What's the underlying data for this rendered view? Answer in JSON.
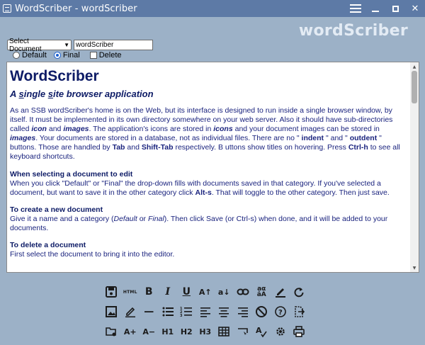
{
  "window": {
    "title": "WordScriber - wordScriber",
    "brand": "wordScriber"
  },
  "controls": {
    "select_value": "Select Document",
    "doc_name_value": "wordScriber",
    "options": [
      {
        "label": "Default",
        "checked": false
      },
      {
        "label": "Final",
        "checked": true
      }
    ],
    "delete_label": "Delete"
  },
  "content": {
    "heading": "WordScriber",
    "subheading_pre": "A ",
    "subheading_u": "s",
    "subheading_mid": "ingle ",
    "subheading_u2": "s",
    "subheading_post": "ite browser application",
    "intro": {
      "t1": "As an SSB wordScriber's home is on the Web, but its interface is designed to run inside a single browser window, by itself. It must be implemented in its own directory somewhere on your web server. Also it should have sub-directories called ",
      "b1": "icon",
      "t2": " and ",
      "b2": "images",
      "t3": ". The application's icons are stored in ",
      "b3": "icons",
      "t4": " and your document images can be stored in ",
      "b4": "images",
      "t5": ". Your documents are stored in a database, not as individual files.  There are no \"",
      "b5": " indent ",
      "t6": "\" and \" ",
      "b6": "outdent",
      "t7": " \" buttons. Those are handled by  ",
      "b7": "Tab",
      "t8": "  and  ",
      "b8": "Shift-Tab",
      "t9": "  respectively. B uttons  show  titles on hovering. Press  ",
      "b9": "Ctrl-h",
      "t10": "  to see all keyboard shortcuts."
    },
    "sec1": {
      "title": "When selecting a document to edit",
      "t1": "When you click \"Default\" or \"Final\" the drop-down fills with documents saved in that category. If you've selected a document, but want to save it in the other category click ",
      "b1": "Alt-s",
      "t2": ". That will toggle to the other category. Then just save."
    },
    "sec2": {
      "title": "To create a new document",
      "t1": "Give it a name and a category (",
      "i1": "Default",
      "t2": " or ",
      "i2": "Final",
      "t3": "). Then click Save (or Ctrl-s) when done, and it will be added to your documents."
    },
    "sec3": {
      "title": "To delete a document",
      "t1": "First select the document to bring it into the editor."
    }
  },
  "toolbar": {
    "row1": [
      "save-icon",
      "HTML",
      "B",
      "I",
      "U",
      "A↑",
      "a↓",
      "link-icon",
      "Aa",
      "pen-icon",
      "redo-icon"
    ],
    "row2": [
      "image-icon",
      "highlight-icon",
      "—",
      "bullet-list-icon",
      "numbered-list-icon",
      "align-left-icon",
      "align-center-icon",
      "align-right-icon",
      "no-icon",
      "help-icon",
      "export-icon"
    ],
    "row3": [
      "folder-settings-icon",
      "A+",
      "A−",
      "H1",
      "H2",
      "H3",
      "table-icon",
      "keyboard-icon",
      "spellcheck-icon",
      "settings-icon",
      "print-icon"
    ],
    "labels": {
      "html": "HTML",
      "bold": "B",
      "italic": "I",
      "underline": "U",
      "superscript": "A↑",
      "subscript": "a↓",
      "case_top": "aα",
      "case_bottom": "âA",
      "rule": "—",
      "font_up": "A+",
      "font_down": "A−",
      "h1": "H1",
      "h2": "H2",
      "h3": "H3"
    }
  }
}
